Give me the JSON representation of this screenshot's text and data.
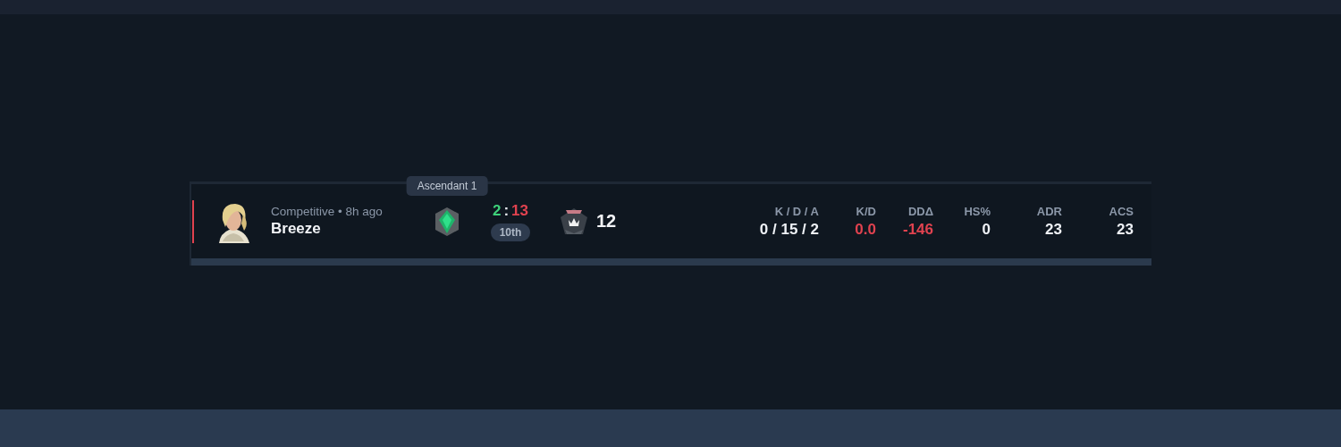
{
  "match": {
    "won": false,
    "mode": "Competitive • 8h ago",
    "map": "Breeze",
    "rank_tooltip": "Ascendant 1",
    "score": {
      "team": "2",
      "separator": ":",
      "enemy": "13"
    },
    "placement": "10th",
    "level": "12",
    "stats": [
      {
        "label": "K / D / A",
        "value": "0 / 15 / 2",
        "negative": false
      },
      {
        "label": "K/D",
        "value": "0.0",
        "negative": true
      },
      {
        "label": "DDΔ",
        "value": "-146",
        "negative": true
      },
      {
        "label": "HS%",
        "value": "0",
        "negative": false
      },
      {
        "label": "ADR",
        "value": "23",
        "negative": false
      },
      {
        "label": "ACS",
        "value": "23",
        "negative": false
      }
    ]
  }
}
